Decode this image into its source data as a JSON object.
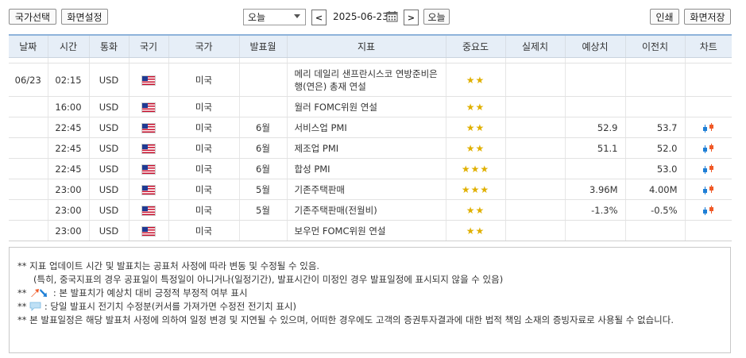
{
  "toolbar": {
    "country_select": "국가선택",
    "screen_settings": "화면설정",
    "period_value": "오늘",
    "date": "2025-06-23",
    "today_button": "오늘",
    "print": "인쇄",
    "save_screen": "화면저장",
    "prev_arrow": "<",
    "next_arrow": ">"
  },
  "table": {
    "headers": [
      "날짜",
      "시간",
      "통화",
      "국기",
      "국가",
      "발표월",
      "지표",
      "중요도",
      "실제치",
      "예상치",
      "이전치",
      "차트"
    ],
    "rows": [
      {
        "date": "06/23",
        "time": "02:15",
        "currency": "USD",
        "country": "미국",
        "month": "",
        "indicator": "메리 데일리 샌프란시스코 연방준비은행(연은) 총재 연설",
        "importance": "★★",
        "actual": "",
        "forecast": "",
        "previous": "",
        "chart": false
      },
      {
        "date": "",
        "time": "16:00",
        "currency": "USD",
        "country": "미국",
        "month": "",
        "indicator": "월러 FOMC위원 연설",
        "importance": "★★",
        "actual": "",
        "forecast": "",
        "previous": "",
        "chart": false
      },
      {
        "date": "",
        "time": "22:45",
        "currency": "USD",
        "country": "미국",
        "month": "6월",
        "indicator": "서비스업 PMI",
        "importance": "★★",
        "actual": "",
        "forecast": "52.9",
        "previous": "53.7",
        "chart": true
      },
      {
        "date": "",
        "time": "22:45",
        "currency": "USD",
        "country": "미국",
        "month": "6월",
        "indicator": "제조업 PMI",
        "importance": "★★",
        "actual": "",
        "forecast": "51.1",
        "previous": "52.0",
        "chart": true
      },
      {
        "date": "",
        "time": "22:45",
        "currency": "USD",
        "country": "미국",
        "month": "6월",
        "indicator": "합성 PMI",
        "importance": "★★★",
        "actual": "",
        "forecast": "",
        "previous": "53.0",
        "chart": true
      },
      {
        "date": "",
        "time": "23:00",
        "currency": "USD",
        "country": "미국",
        "month": "5월",
        "indicator": "기존주택판매",
        "importance": "★★★",
        "actual": "",
        "forecast": "3.96M",
        "previous": "4.00M",
        "chart": true
      },
      {
        "date": "",
        "time": "23:00",
        "currency": "USD",
        "country": "미국",
        "month": "5월",
        "indicator": "기존주택판매(전월비)",
        "importance": "★★",
        "actual": "",
        "forecast": "-1.3%",
        "previous": "-0.5%",
        "chart": true
      },
      {
        "date": "",
        "time": "23:00",
        "currency": "USD",
        "country": "미국",
        "month": "",
        "indicator": "보우먼 FOMC위원 연설",
        "importance": "★★",
        "actual": "",
        "forecast": "",
        "previous": "",
        "chart": false
      }
    ]
  },
  "notes": {
    "line1": "** 지표 업데이트 시간 및 발표치는 공표처 사정에 따라 변동 및 수정될 수 있음.",
    "line2": "(특히, 중국지표의 경우 공표일이 특정일이 아니거나(일정기간), 발표시간이 미정인 경우 발표일정에 표시되지 않을 수 있음)",
    "line3_prefix": "**",
    "line3": ": 본 발표치가 예상치 대비 긍정적 부정적 여부 표시",
    "line4_prefix": "**",
    "line4": ": 당일 발표시 전기치 수정분(커서를 가져가면 수정전 전기치 표시)",
    "line5": "** 본 발표일정은 해당 발표처 사정에 의하여 일정 변경 및 지연될 수 있으며, 어떠한 경우에도 고객의 증권투자결과에 대한 법적 책임 소재의 증빙자료로 사용될 수 없습니다."
  },
  "colors": {
    "header_bg": "#e6eef7",
    "header_top_border": "#8eb3da",
    "star": "#e0b000",
    "candle_up": "#f05a28",
    "candle_down": "#1e7fd6"
  }
}
